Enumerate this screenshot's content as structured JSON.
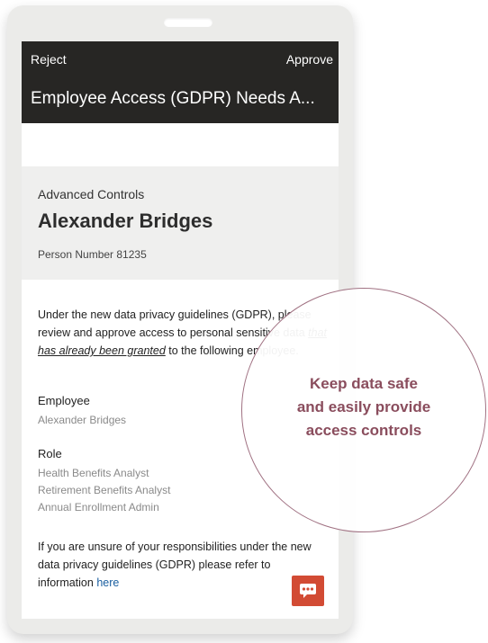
{
  "header": {
    "reject_label": "Reject",
    "approve_label": "Approve",
    "title": "Employee Access (GDPR) Needs A..."
  },
  "person": {
    "section_label": "Advanced Controls",
    "name": "Alexander Bridges",
    "number": "Person Number 81235"
  },
  "intro": {
    "part1": "Under the new data privacy guidelines (GDPR), please review and approve access to personal sensitive data ",
    "emphasis": "that has already been granted",
    "part2": " to the following employee."
  },
  "employee": {
    "label": "Employee",
    "value": "Alexander Bridges"
  },
  "role": {
    "label": "Role",
    "items": [
      "Health Benefits Analyst",
      "Retirement Benefits Analyst",
      "Annual Enrollment Admin"
    ]
  },
  "help": {
    "text": "If you are unsure of your responsibilities under the new data privacy guidelines (GDPR) please refer to information ",
    "link": "here"
  },
  "callout": {
    "lines": [
      "Keep data safe",
      "and easily provide",
      "access controls"
    ]
  },
  "colors": {
    "header_bg": "#272624",
    "card_bg": "#efefee",
    "chat_button": "#d24b34",
    "callout_text": "#8a4d5d",
    "link": "#1a5fa0"
  },
  "icons": {
    "chat": "chat-bubble-icon"
  }
}
